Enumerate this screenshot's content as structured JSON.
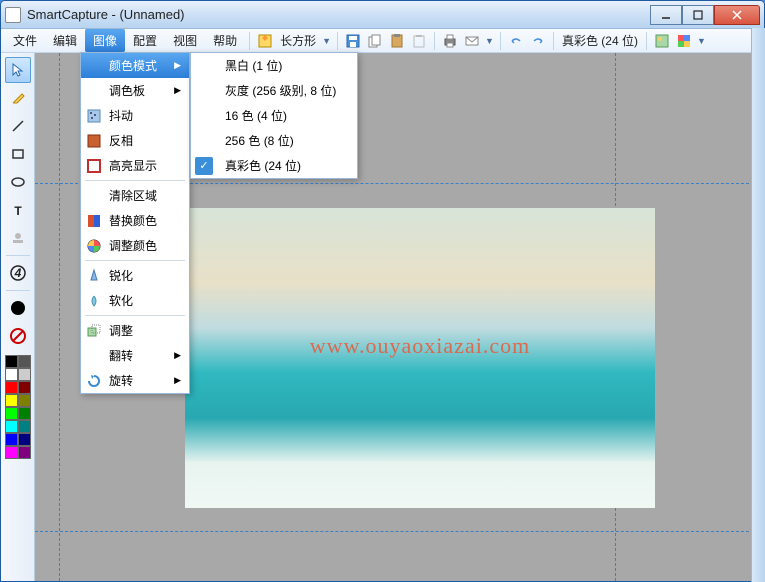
{
  "window": {
    "title": "SmartCapture - (Unnamed)"
  },
  "menubar": {
    "items": [
      "文件",
      "编辑",
      "图像",
      "配置",
      "视图",
      "帮助"
    ],
    "active_index": 2
  },
  "toolbar": {
    "shape_label": "长方形",
    "color_mode_label": "真彩色 (24 位)"
  },
  "dropdown_main": {
    "items": [
      {
        "label": "颜色模式",
        "has_arrow": true,
        "highlight": true,
        "icon": ""
      },
      {
        "label": "调色板",
        "has_arrow": true,
        "icon": ""
      },
      {
        "label": "抖动",
        "icon": "dither"
      },
      {
        "label": "反相",
        "icon": "invert"
      },
      {
        "label": "高亮显示",
        "icon": "highlight",
        "sep_after": true
      },
      {
        "label": "清除区域",
        "icon": ""
      },
      {
        "label": "替换颜色",
        "icon": "replace"
      },
      {
        "label": "调整颜色",
        "icon": "adjust",
        "sep_after": true
      },
      {
        "label": "锐化",
        "icon": "sharpen"
      },
      {
        "label": "软化",
        "icon": "soften",
        "sep_after": true
      },
      {
        "label": "调整",
        "icon": "resize"
      },
      {
        "label": "翻转",
        "has_arrow": true,
        "icon": ""
      },
      {
        "label": "旋转",
        "has_arrow": true,
        "icon": "rotate"
      }
    ]
  },
  "dropdown_sub": {
    "items": [
      {
        "label": "黑白 (1 位)",
        "checked": false
      },
      {
        "label": "灰度 (256 级别, 8 位)",
        "checked": false
      },
      {
        "label": "16 色 (4 位)",
        "checked": false
      },
      {
        "label": "256 色 (8 位)",
        "checked": false
      },
      {
        "label": "真彩色 (24 位)",
        "checked": true
      }
    ]
  },
  "watermark": "www.ouyaoxiazai.com",
  "palette_colors": [
    [
      "#000000",
      "#000000"
    ],
    [
      "#ffffff",
      "#ffffff"
    ],
    [
      "#ff0000",
      "#800000"
    ],
    [
      "#ffff00",
      "#808000"
    ],
    [
      "#00ff00",
      "#008000"
    ],
    [
      "#00ffff",
      "#008080"
    ],
    [
      "#0000ff",
      "#000080"
    ],
    [
      "#ff00ff",
      "#800080"
    ]
  ]
}
